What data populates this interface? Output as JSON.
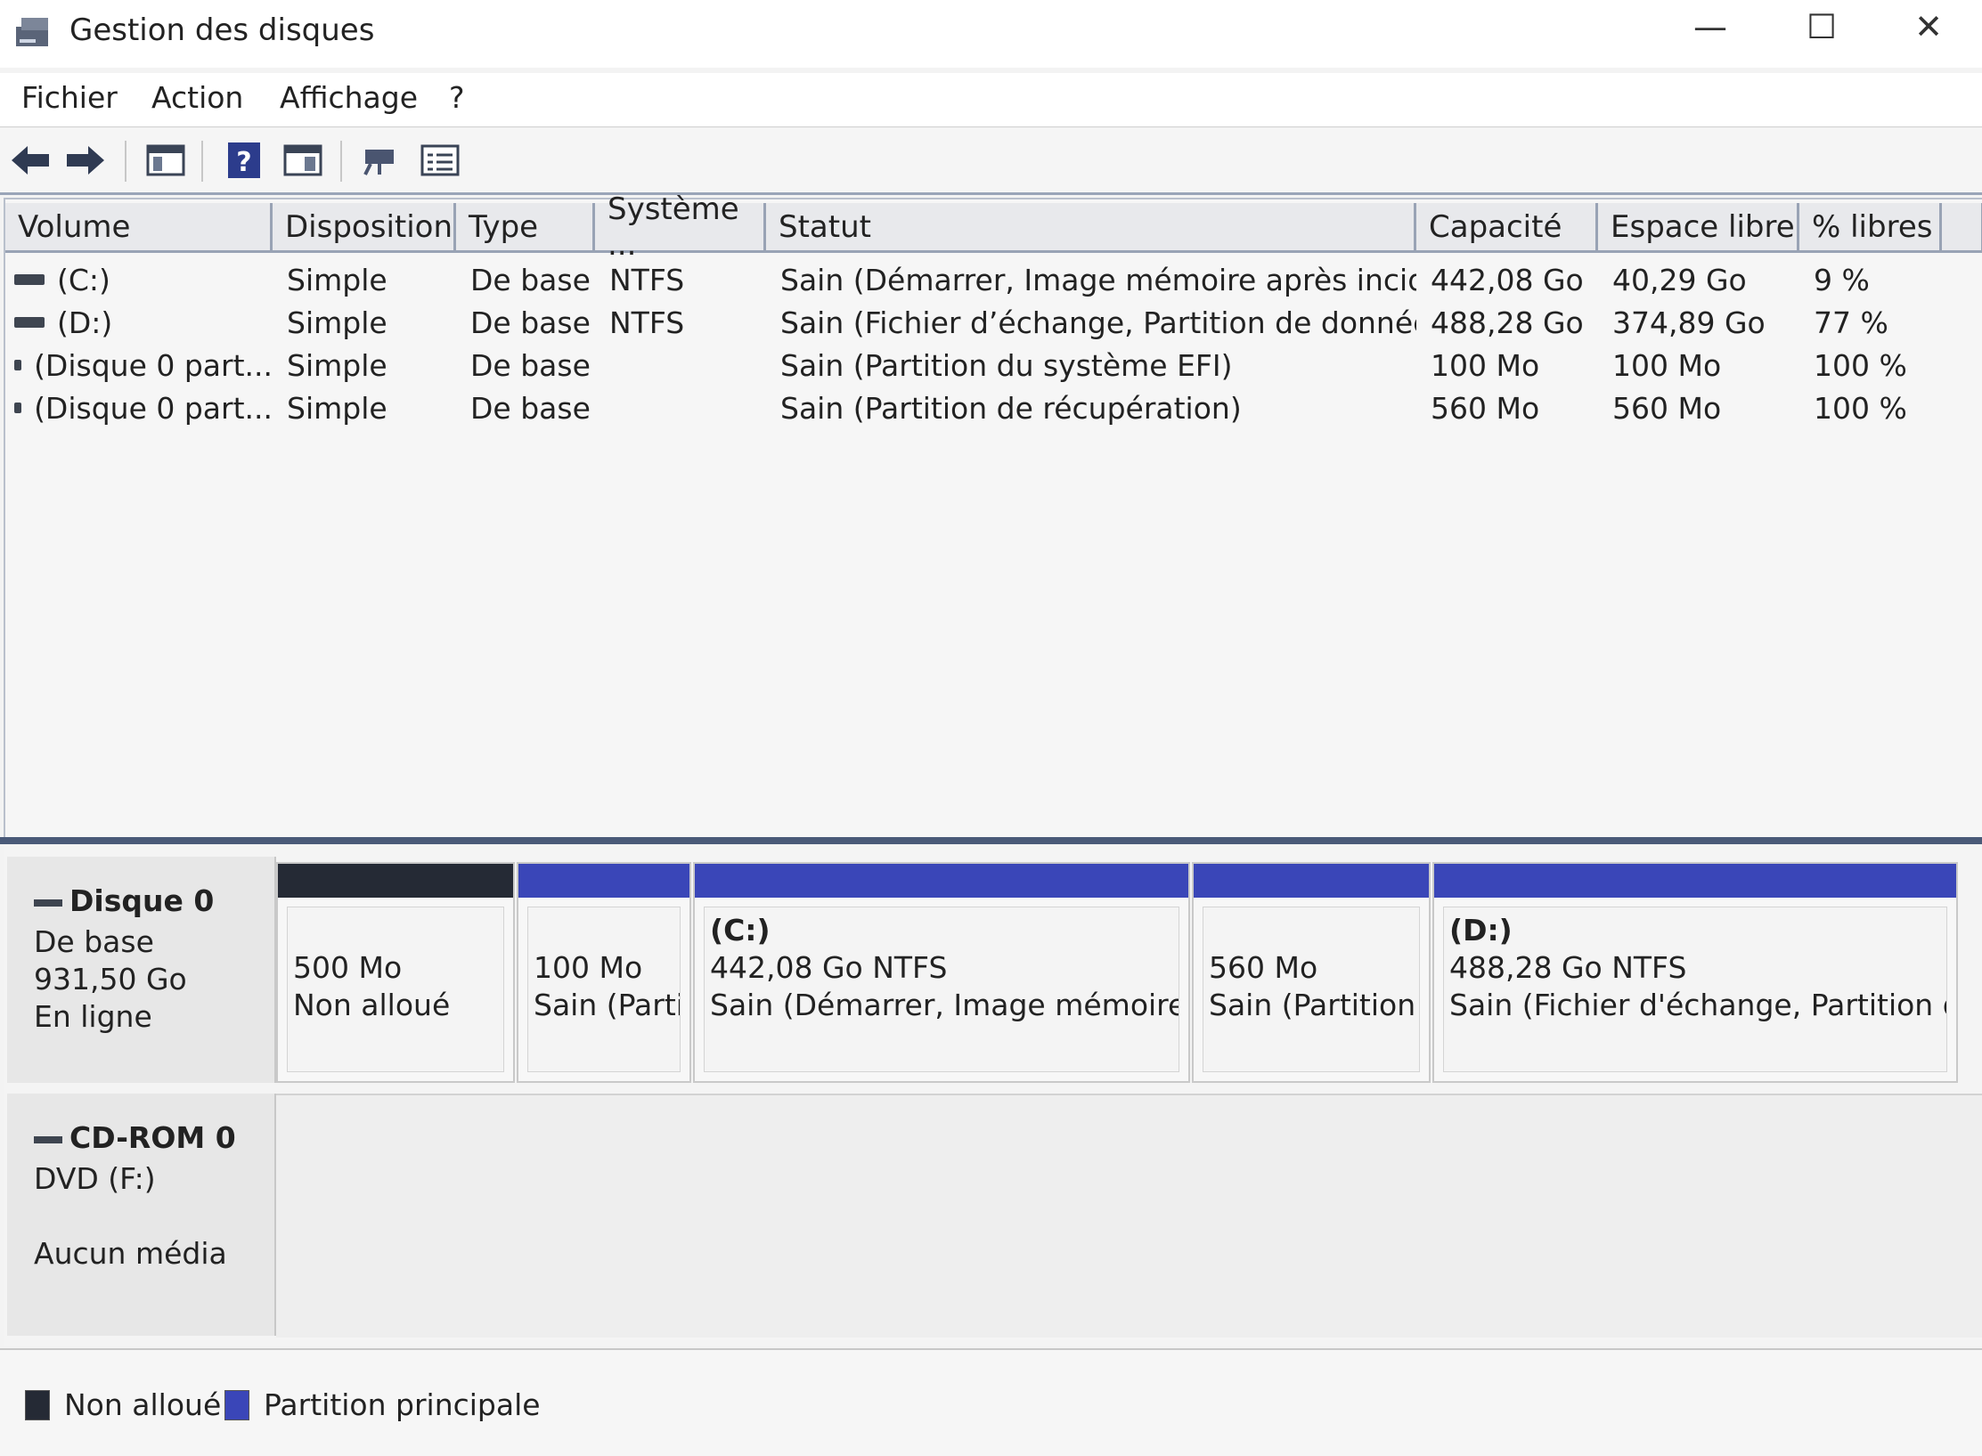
{
  "window": {
    "title": "Gestion des disques",
    "minimize_glyph": "—",
    "maximize_glyph": "☐",
    "close_glyph": "✕"
  },
  "menu": [
    "Fichier",
    "Action",
    "Affichage",
    "?"
  ],
  "toolbar": {
    "icons": [
      "back-arrow-icon",
      "forward-arrow-icon",
      "console-tree-icon",
      "help-icon",
      "properties-icon",
      "disk-connect-icon",
      "list-settings-icon"
    ]
  },
  "volume_table": {
    "columns": [
      "Volume",
      "Disposition",
      "Type",
      "Système ...",
      "Statut",
      "Capacité",
      "Espace libre",
      "% libres"
    ],
    "rows": [
      [
        "(C:)",
        "Simple",
        "De base",
        "NTFS",
        "Sain (Démarrer, Image mémoire après incide...",
        "442,08 Go",
        "40,29 Go",
        "9 %"
      ],
      [
        "(D:)",
        "Simple",
        "De base",
        "NTFS",
        "Sain (Fichier d’échange, Partition de données...",
        "488,28 Go",
        "374,89 Go",
        "77 %"
      ],
      [
        "(Disque 0 part...",
        "Simple",
        "De base",
        "",
        "Sain (Partition du système EFI)",
        "100 Mo",
        "100 Mo",
        "100 %"
      ],
      [
        "(Disque 0 part...",
        "Simple",
        "De base",
        "",
        "Sain (Partition de récupération)",
        "560 Mo",
        "560 Mo",
        "100 %"
      ]
    ]
  },
  "disk0": {
    "name": "Disque 0",
    "type": "De base",
    "size": "931,50 Go",
    "state": "En ligne",
    "partitions": [
      {
        "label": "",
        "size": "500 Mo",
        "status": "Non alloué",
        "kind": "unallocated"
      },
      {
        "label": "",
        "size": "100 Mo",
        "status": "Sain (Parti",
        "kind": "primary"
      },
      {
        "label": "(C:)",
        "size": "442,08 Go NTFS",
        "status": "Sain (Démarrer, Image mémoire ap",
        "kind": "primary"
      },
      {
        "label": "",
        "size": "560 Mo",
        "status": "Sain (Partition (",
        "kind": "primary"
      },
      {
        "label": "(D:)",
        "size": "488,28 Go NTFS",
        "status": "Sain (Fichier d'échange, Partition de",
        "kind": "primary"
      }
    ]
  },
  "cdrom0": {
    "name": "CD-ROM 0",
    "drive": "DVD (F:)",
    "media": "Aucun média"
  },
  "legend": {
    "unallocated": "Non alloué",
    "primary": "Partition principale"
  },
  "colors": {
    "unallocated": "#252a35",
    "primary": "#3a46b8"
  }
}
